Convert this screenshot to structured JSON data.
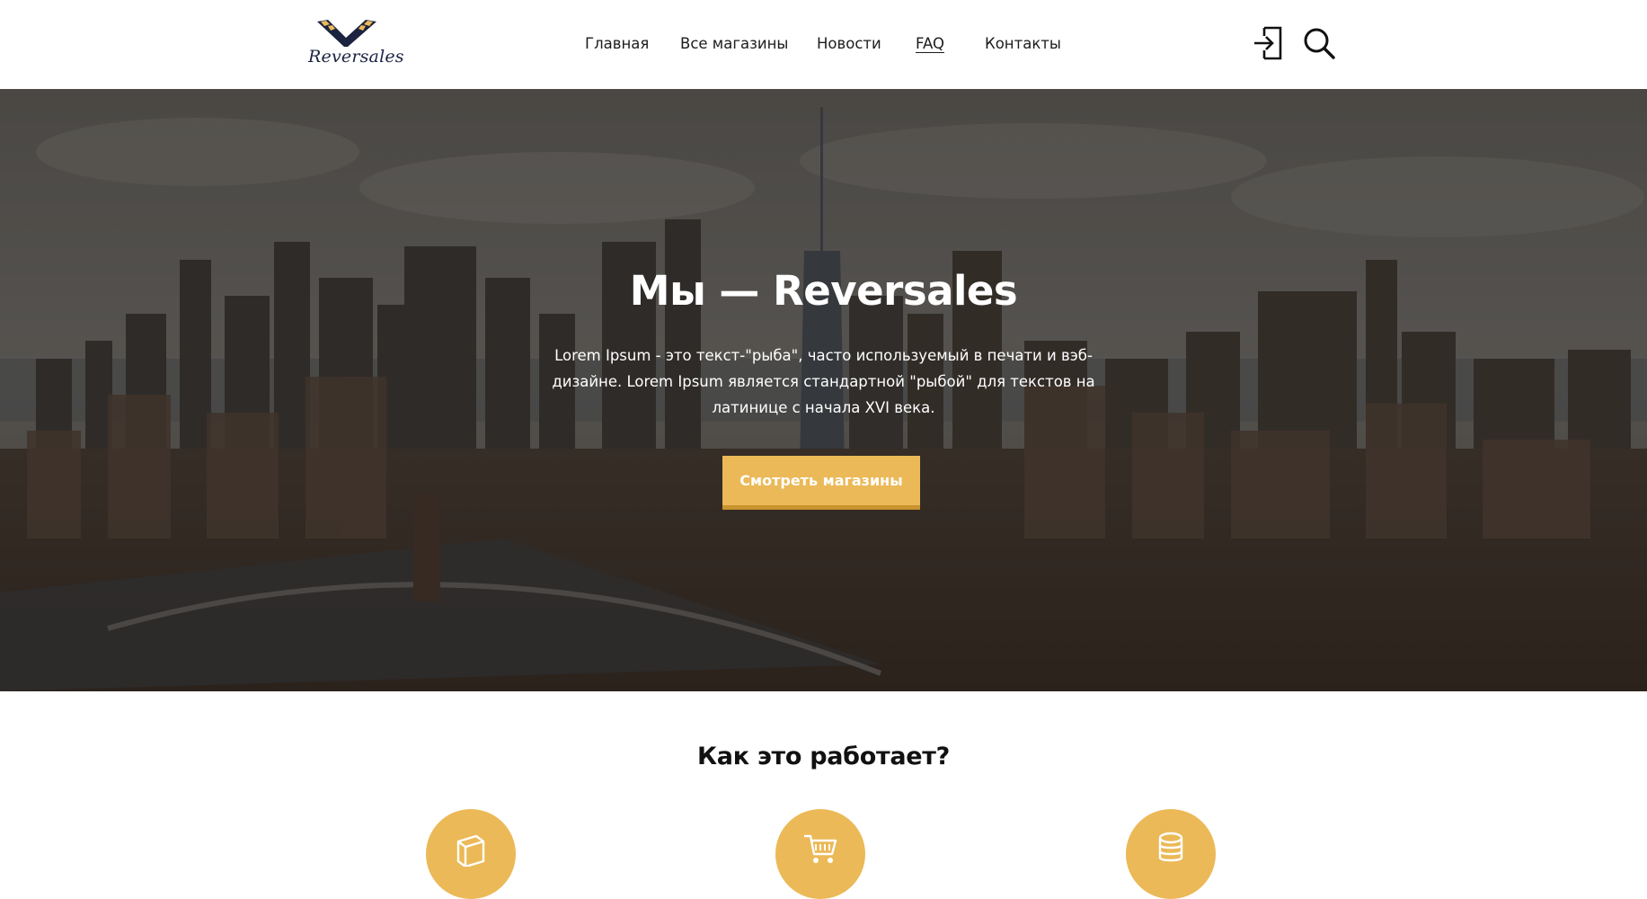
{
  "brand": {
    "name": "Reversales",
    "colors": {
      "accent": "#ebb957",
      "accent_dark": "#c9932f",
      "navy": "#1b2340"
    }
  },
  "nav": {
    "items": [
      {
        "label": "Главная"
      },
      {
        "label": "Все магазины"
      },
      {
        "label": "Новости"
      },
      {
        "label": "FAQ"
      },
      {
        "label": "Контакты"
      }
    ]
  },
  "header_icons": {
    "login": "login-icon",
    "search": "search-icon"
  },
  "hero": {
    "title": "Мы — Reversales",
    "text": "Lorem Ipsum - это текст-\"рыба\", часто используемый в печати и вэб-дизайне. Lorem Ipsum является стандартной \"рыбой\" для текстов на латинице с начала XVI века.",
    "button_label": "Смотреть магазины",
    "background": "city-skyline-image"
  },
  "how_it_works": {
    "title": "Как это работает?",
    "steps": [
      {
        "icon": "box-icon"
      },
      {
        "icon": "cart-icon"
      },
      {
        "icon": "coins-icon"
      }
    ]
  }
}
